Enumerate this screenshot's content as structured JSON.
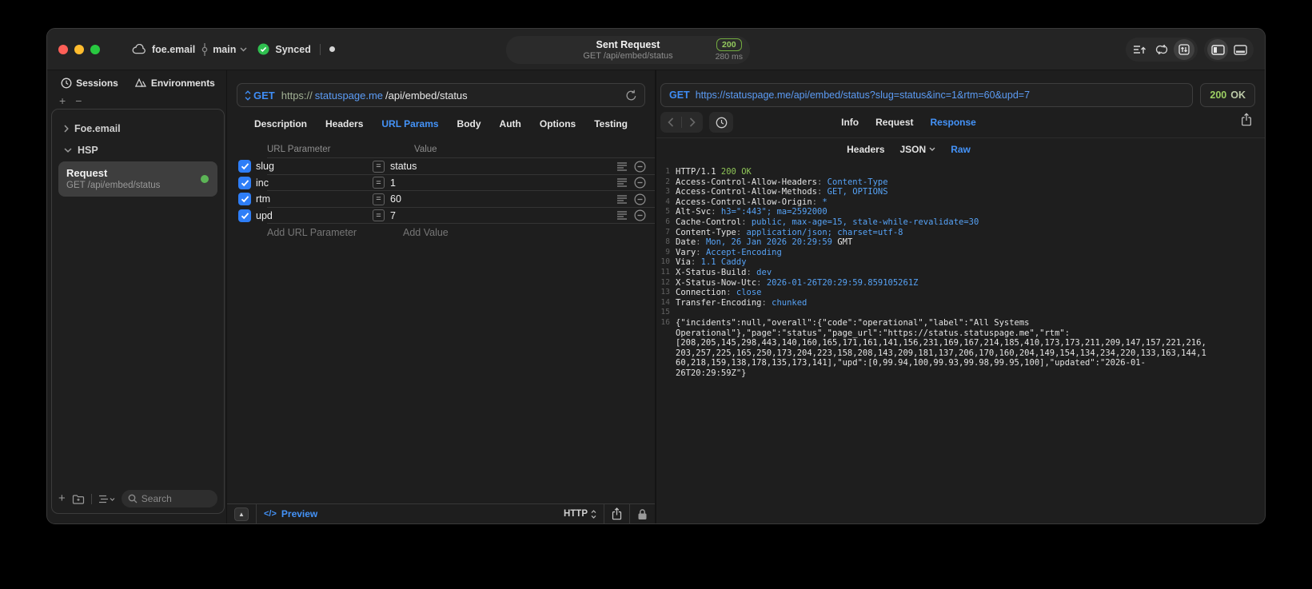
{
  "titlebar": {
    "project": "foe.email",
    "branch": "main",
    "synced": "Synced",
    "request_title": "Sent Request",
    "request_subtitle": "GET /api/embed/status",
    "status_code": "200",
    "duration": "280 ms"
  },
  "sidebar": {
    "tabs": [
      {
        "label": "Sessions",
        "active": true
      },
      {
        "label": "Environments",
        "active": false
      }
    ],
    "groups": [
      {
        "label": "Foe.email",
        "expanded": false
      },
      {
        "label": "HSP",
        "expanded": true
      }
    ],
    "request_item": {
      "title": "Request",
      "subtitle": "GET /api/embed/status",
      "selected": true
    },
    "search_placeholder": "Search"
  },
  "editor": {
    "method": "GET",
    "url": {
      "scheme": "https://",
      "host": "statuspage.me",
      "path": "/api/embed/status"
    },
    "tabs": [
      "Description",
      "Headers",
      "URL Params",
      "Body",
      "Auth",
      "Options",
      "Testing"
    ],
    "active_tab": "URL Params",
    "table": {
      "columns": [
        "URL Parameter",
        "Value"
      ],
      "rows": [
        {
          "name": "slug",
          "value": "status",
          "checked": true
        },
        {
          "name": "inc",
          "value": "1",
          "checked": true
        },
        {
          "name": "rtm",
          "value": "60",
          "checked": true
        },
        {
          "name": "upd",
          "value": "7",
          "checked": true
        }
      ],
      "add_param_placeholder": "Add URL Parameter",
      "add_value_placeholder": "Add Value"
    },
    "footer": {
      "preview": "Preview",
      "protocol": "HTTP"
    }
  },
  "response": {
    "request_method": "GET",
    "request_url": "https://statuspage.me/api/embed/status?slug=status&inc=1&rtm=60&upd=7",
    "status_code": "200",
    "status_text": "OK",
    "tabs": [
      "Info",
      "Request",
      "Response"
    ],
    "active_tab": "Response",
    "subtabs": [
      {
        "label": "Headers",
        "active": false,
        "dropdown": false
      },
      {
        "label": "JSON",
        "active": false,
        "dropdown": true
      },
      {
        "label": "Raw",
        "active": true,
        "dropdown": false
      }
    ],
    "body_lines": [
      {
        "n": "1",
        "parts": [
          [
            "HTTP/1.1 ",
            "k"
          ],
          [
            "200 OK",
            "g"
          ]
        ]
      },
      {
        "n": "2",
        "parts": [
          [
            "Access-Control-Allow-Headers",
            "k"
          ],
          [
            ": ",
            "s"
          ],
          [
            "Content-Type",
            "v"
          ]
        ]
      },
      {
        "n": "3",
        "parts": [
          [
            "Access-Control-Allow-Methods",
            "k"
          ],
          [
            ": ",
            "s"
          ],
          [
            "GET, OPTIONS",
            "v"
          ]
        ]
      },
      {
        "n": "4",
        "parts": [
          [
            "Access-Control-Allow-Origin",
            "k"
          ],
          [
            ": ",
            "s"
          ],
          [
            "*",
            "v"
          ]
        ]
      },
      {
        "n": "5",
        "parts": [
          [
            "Alt-Svc",
            "k"
          ],
          [
            ": ",
            "s"
          ],
          [
            "h3=\":443\"; ma=2592000",
            "v"
          ]
        ]
      },
      {
        "n": "6",
        "parts": [
          [
            "Cache-Control",
            "k"
          ],
          [
            ": ",
            "s"
          ],
          [
            "public, max-age=15, stale-while-revalidate=30",
            "v"
          ]
        ]
      },
      {
        "n": "7",
        "parts": [
          [
            "Content-Type",
            "k"
          ],
          [
            ": ",
            "s"
          ],
          [
            "application/json; charset=utf-8",
            "v"
          ]
        ]
      },
      {
        "n": "8",
        "parts": [
          [
            "Date",
            "k"
          ],
          [
            ": ",
            "s"
          ],
          [
            "Mon, 26 Jan 2026 20:29:59",
            "v"
          ],
          [
            " GMT",
            "k"
          ]
        ]
      },
      {
        "n": "9",
        "parts": [
          [
            "Vary",
            "k"
          ],
          [
            ": ",
            "s"
          ],
          [
            "Accept-Encoding",
            "v"
          ]
        ]
      },
      {
        "n": "10",
        "parts": [
          [
            "Via",
            "k"
          ],
          [
            ": ",
            "s"
          ],
          [
            "1.1 Caddy",
            "v"
          ]
        ]
      },
      {
        "n": "11",
        "parts": [
          [
            "X-Status-Build",
            "k"
          ],
          [
            ": ",
            "s"
          ],
          [
            "dev",
            "v"
          ]
        ]
      },
      {
        "n": "12",
        "parts": [
          [
            "X-Status-Now-Utc",
            "k"
          ],
          [
            ": ",
            "s"
          ],
          [
            "2026-01-26T20:29:59.859105261Z",
            "v"
          ]
        ]
      },
      {
        "n": "13",
        "parts": [
          [
            "Connection",
            "k"
          ],
          [
            ": ",
            "s"
          ],
          [
            "close",
            "v"
          ]
        ]
      },
      {
        "n": "14",
        "parts": [
          [
            "Transfer-Encoding",
            "k"
          ],
          [
            ": ",
            "s"
          ],
          [
            "chunked",
            "v"
          ]
        ]
      },
      {
        "n": "15",
        "parts": []
      },
      {
        "n": "16",
        "parts": [
          [
            "{\"incidents\":null,\"overall\":{\"code\":\"operational\",\"label\":\"All Systems Operational\"},\"page\":\"status\",\"page_url\":\"https://status.statuspage.me\",\"rtm\":[208,205,145,298,443,140,160,165,171,161,141,156,231,169,167,214,185,410,173,173,211,209,147,157,221,216,203,257,225,165,250,173,204,223,158,208,143,209,181,137,206,170,160,204,149,154,134,234,220,133,163,144,160,218,159,138,178,135,173,141],\"upd\":[0,99.94,100,99.93,99.98,99.95,100],\"updated\":\"2026-01-26T20:29:59Z\"}",
            "k"
          ]
        ]
      }
    ]
  },
  "colors": {
    "accent_blue": "#4493f8",
    "value_blue": "#56a2f5",
    "status_green": "#8ec457",
    "badge_green": "#94ca5e",
    "traffic_red": "#ff5f57",
    "traffic_yellow": "#febc2e",
    "traffic_green": "#28c840",
    "checkbox_blue": "#2e7ef7"
  }
}
